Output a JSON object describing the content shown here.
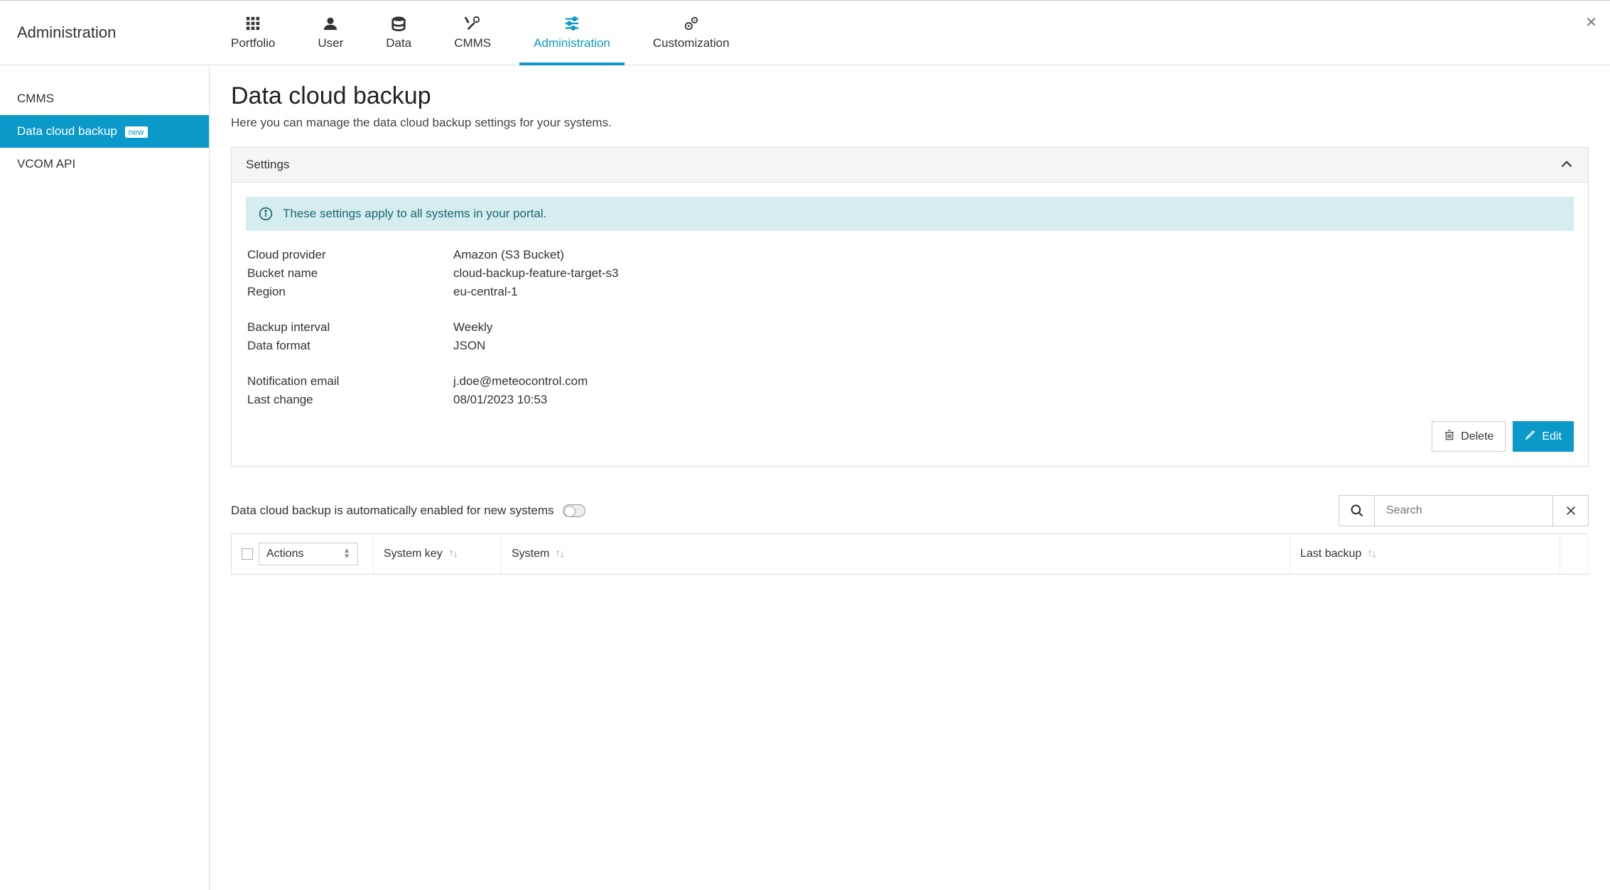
{
  "topbar": {
    "title": "Administration",
    "nav": [
      {
        "label": "Portfolio"
      },
      {
        "label": "User"
      },
      {
        "label": "Data"
      },
      {
        "label": "CMMS"
      },
      {
        "label": "Administration"
      },
      {
        "label": "Customization"
      }
    ]
  },
  "sidebar": {
    "items": [
      {
        "label": "CMMS"
      },
      {
        "label": "Data cloud backup",
        "badge": "new"
      },
      {
        "label": "VCOM API"
      }
    ]
  },
  "page": {
    "title": "Data cloud backup",
    "description": "Here you can manage the data cloud backup settings for your systems."
  },
  "settings_panel": {
    "title": "Settings",
    "info": "These settings apply to all systems in your portal.",
    "rows": {
      "cloud_provider_label": "Cloud provider",
      "cloud_provider_value": "Amazon (S3 Bucket)",
      "bucket_name_label": "Bucket name",
      "bucket_name_value": "cloud-backup-feature-target-s3",
      "region_label": "Region",
      "region_value": "eu-central-1",
      "backup_interval_label": "Backup interval",
      "backup_interval_value": "Weekly",
      "data_format_label": "Data format",
      "data_format_value": "JSON",
      "notification_email_label": "Notification email",
      "notification_email_value": "j.doe@meteocontrol.com",
      "last_change_label": "Last change",
      "last_change_value": "08/01/2023 10:53"
    },
    "delete_label": "Delete",
    "edit_label": "Edit"
  },
  "auto_enable": {
    "label": "Data cloud backup is automatically enabled for new systems"
  },
  "search": {
    "placeholder": "Search"
  },
  "table": {
    "actions_label": "Actions",
    "columns": {
      "system_key": "System key",
      "system": "System",
      "last_backup": "Last backup"
    }
  }
}
